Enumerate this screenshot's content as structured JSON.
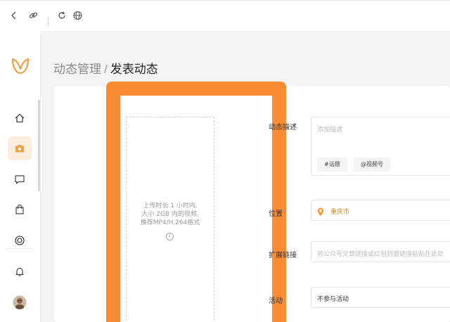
{
  "browser": {
    "icons": [
      "back-icon",
      "link-icon",
      "reload-icon",
      "globe-icon"
    ]
  },
  "sidebar": {
    "logo": "logo-icon",
    "items": [
      {
        "icon": "home-icon",
        "active": false
      },
      {
        "icon": "camera-icon",
        "active": true
      },
      {
        "icon": "message-icon",
        "active": false
      },
      {
        "icon": "bag-icon",
        "active": false
      },
      {
        "icon": "target-icon",
        "active": false
      },
      {
        "icon": "bell-icon",
        "active": false
      },
      {
        "icon": "avatar",
        "active": false
      }
    ],
    "accent_color": "#f0a040"
  },
  "breadcrumb": {
    "parent": "动态管理",
    "separator": "/",
    "current": "发表动态"
  },
  "upload": {
    "line1": "上传时长 1 小时内,",
    "line2": "大小 2GB 内的视频,",
    "line3": "推荐MP4/H.264格式",
    "info_icon": "i"
  },
  "form": {
    "description": {
      "label": "动态描述",
      "placeholder": "添加描述",
      "tags": [
        "#话题",
        "@视频号"
      ]
    },
    "location": {
      "label": "位置",
      "value": "重庆市"
    },
    "extended_link": {
      "label": "扩展链接",
      "placeholder": "将公众号文章链接或红包封面链接粘贴在此处"
    },
    "activity": {
      "label": "活动",
      "value": "不参与活动"
    }
  },
  "highlight_color": "#fa8c35"
}
